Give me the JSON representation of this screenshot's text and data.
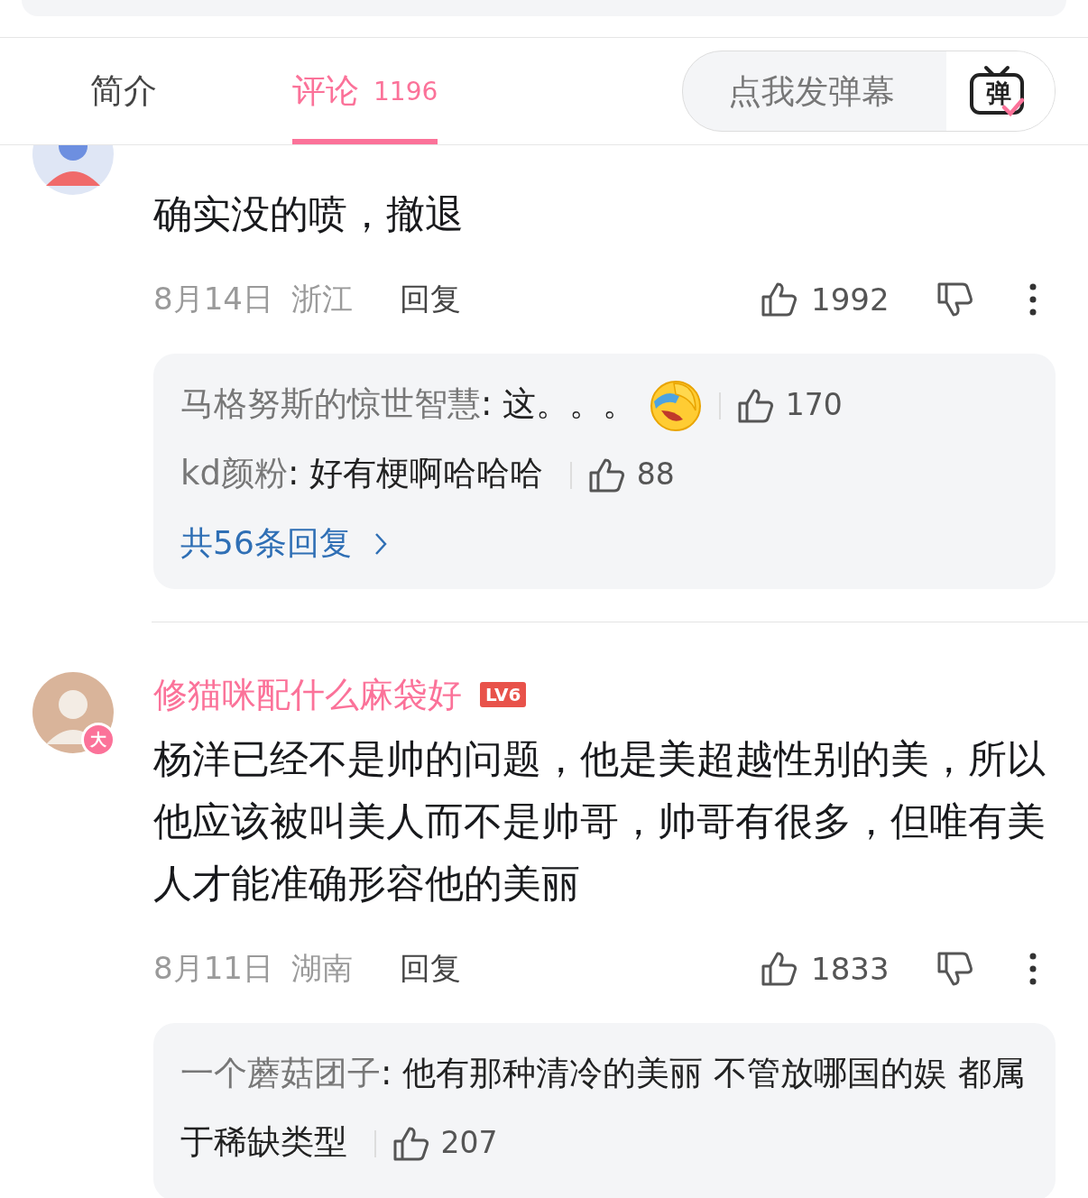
{
  "tabs": [
    {
      "label": "简介",
      "selected": false
    },
    {
      "label": "评论",
      "count": "1196",
      "selected": true
    }
  ],
  "danmaku": {
    "placeholder": "点我发弹幕",
    "button": "弹"
  },
  "comments": [
    {
      "text": "确实没的喷，撤退",
      "date": "8月14日",
      "location": "浙江",
      "reply_label": "回复",
      "likes": "1992",
      "replies": [
        {
          "user": "马格努斯的惊世智慧",
          "text": ": 这。。。",
          "emoji": true,
          "likes": "170"
        },
        {
          "user": "kd颜粉",
          "text": ": 好有梗啊哈哈哈",
          "emoji": false,
          "likes": "88"
        }
      ],
      "more_replies": "共56条回复"
    },
    {
      "username": "修猫咪配什么麻袋好",
      "level": "LV6",
      "avatar_badge": "大",
      "text": "杨洋已经不是帅的问题，他是美超越性别的美，所以他应该被叫美人而不是帅哥，帅哥有很多，但唯有美人才能准确形容他的美丽",
      "date": "8月11日",
      "location": "湖南",
      "reply_label": "回复",
      "likes": "1833",
      "replies": [
        {
          "user": "一个蘑菇团子",
          "text": ": 他有那种清冷的美丽  不管放哪国的娱 都属于稀缺类型",
          "emoji": false,
          "likes": "207"
        }
      ]
    }
  ]
}
